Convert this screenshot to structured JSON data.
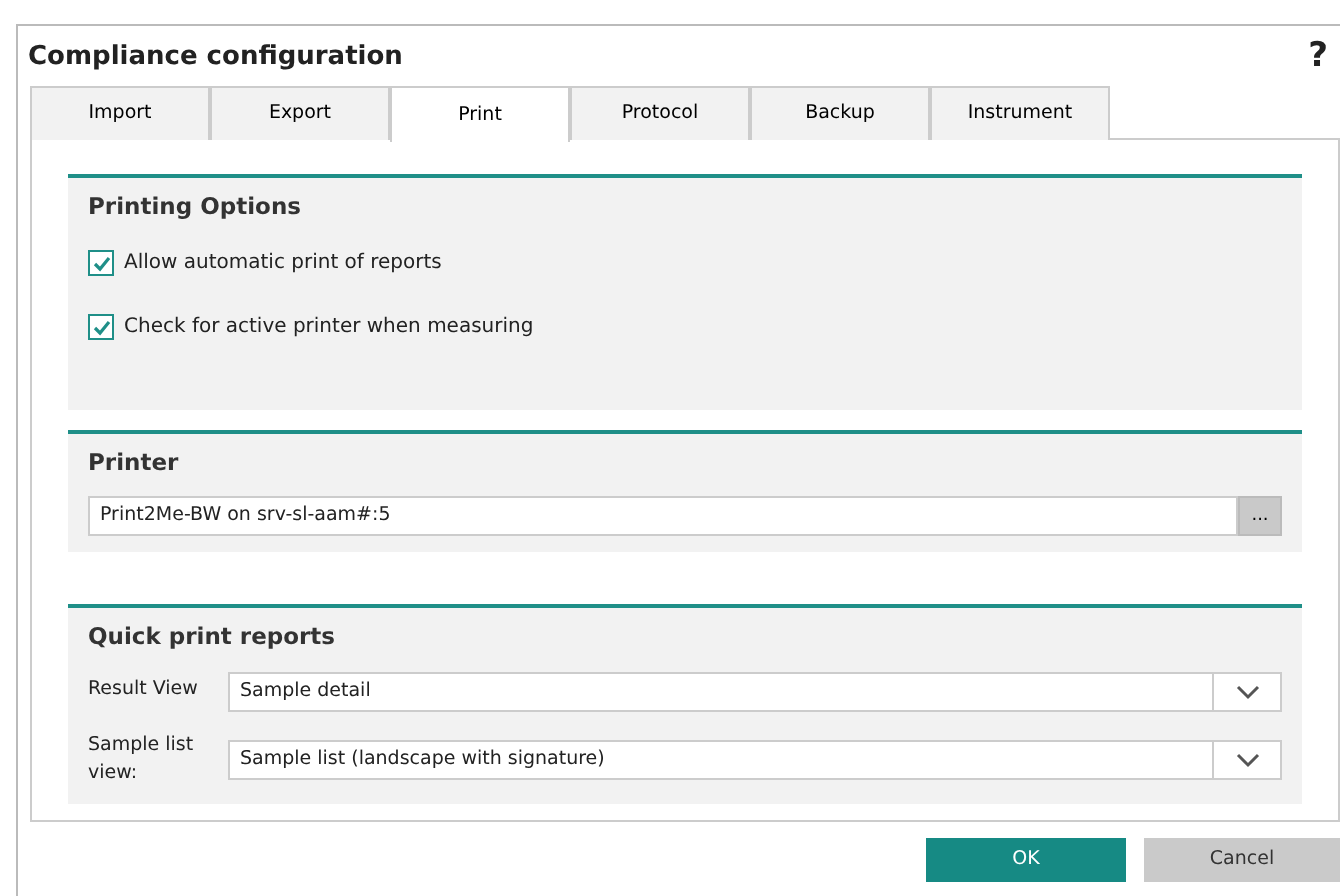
{
  "window": {
    "title": "Compliance configuration",
    "help": "?"
  },
  "tabs": [
    {
      "label": "Import",
      "selected": false
    },
    {
      "label": "Export",
      "selected": false
    },
    {
      "label": "Print",
      "selected": true
    },
    {
      "label": "Protocol",
      "selected": false
    },
    {
      "label": "Backup",
      "selected": false
    },
    {
      "label": "Instrument",
      "selected": false
    }
  ],
  "printing_options": {
    "title": "Printing Options",
    "options": [
      {
        "label": "Allow automatic print of reports",
        "checked": true
      },
      {
        "label": "Check for active printer when measuring",
        "checked": true
      }
    ]
  },
  "printer": {
    "title": "Printer",
    "value": "Print2Me-BW on srv-sl-aam#:5",
    "browse": "..."
  },
  "quick_print": {
    "title": "Quick print reports",
    "rows": [
      {
        "label": "Result View",
        "value": "Sample detail"
      },
      {
        "label": "Sample list view:",
        "value": "Sample list (landscape with signature)"
      }
    ]
  },
  "buttons": [
    {
      "label": "OK",
      "kind": "primary"
    },
    {
      "label": "Cancel",
      "kind": "secondary"
    }
  ]
}
